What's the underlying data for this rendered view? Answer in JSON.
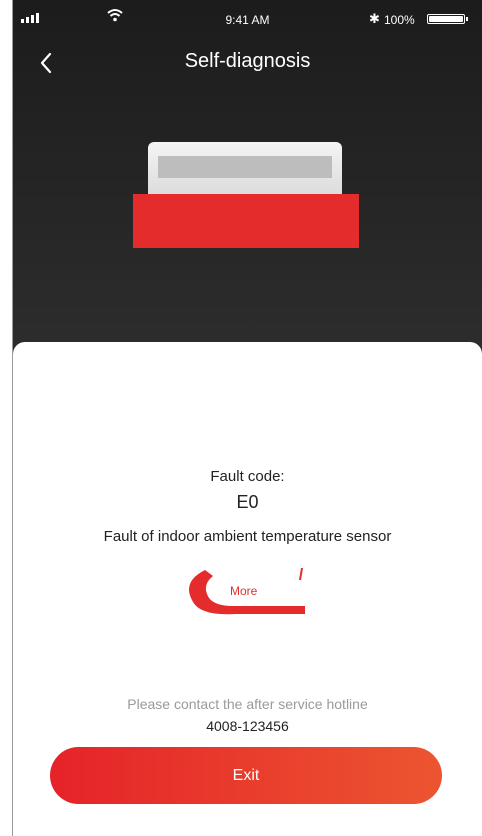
{
  "status_bar": {
    "time": "9:41 AM",
    "battery": "100%",
    "signal_icon": "signal-bars-icon",
    "wifi_icon": "wifi-icon",
    "bluetooth_icon": "bluetooth-icon",
    "battery_icon": "battery-icon"
  },
  "header": {
    "title": "Self-diagnosis",
    "back_icon": "chevron-left-icon"
  },
  "fault": {
    "label": "Fault code:",
    "code": "E0",
    "description": "Fault of indoor ambient temperature sensor",
    "more_label": "More"
  },
  "contact": {
    "text": "Please contact the after service hotline",
    "hotline": "4008-123456"
  },
  "actions": {
    "exit_label": "Exit"
  },
  "colors": {
    "accent": "#e52c2c",
    "header_bg": "#262626",
    "exit_gradient_start": "#e52329",
    "exit_gradient_end": "#ec5530"
  }
}
